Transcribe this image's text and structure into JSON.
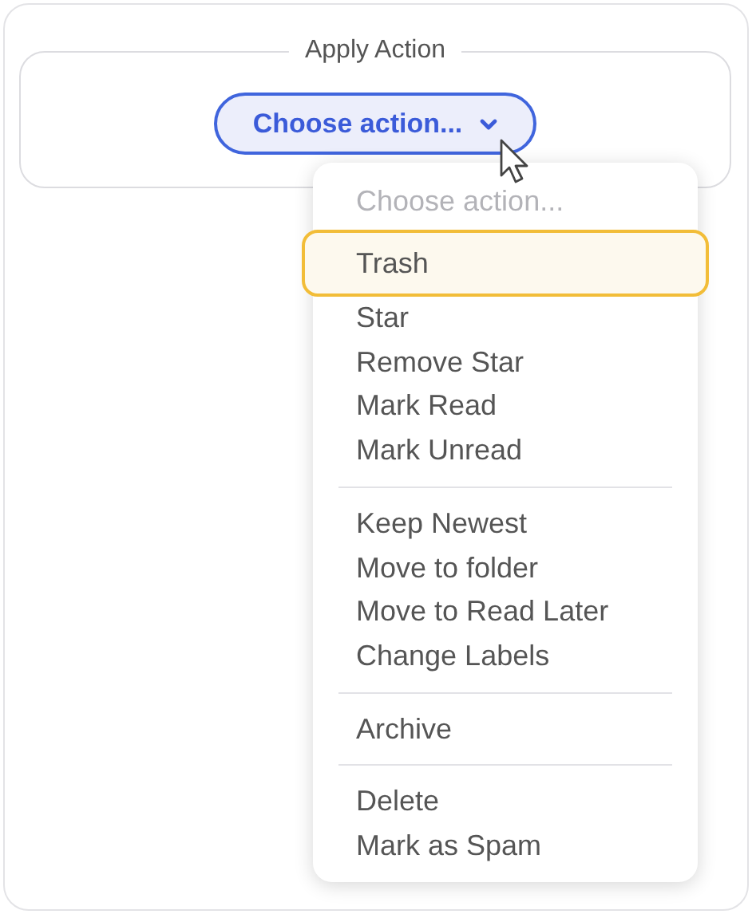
{
  "fieldset": {
    "legend": "Apply Action"
  },
  "select": {
    "value": "Choose action...",
    "expanded": true
  },
  "menu": {
    "placeholder": "Choose action...",
    "groups": [
      {
        "items": [
          {
            "label": "Trash",
            "selected": true
          },
          {
            "label": "Star",
            "selected": false
          },
          {
            "label": "Remove Star",
            "selected": false
          },
          {
            "label": "Mark Read",
            "selected": false
          },
          {
            "label": "Mark Unread",
            "selected": false
          }
        ]
      },
      {
        "items": [
          {
            "label": "Keep Newest",
            "selected": false
          },
          {
            "label": "Move to folder",
            "selected": false
          },
          {
            "label": "Move to Read Later",
            "selected": false
          },
          {
            "label": "Change Labels",
            "selected": false
          }
        ]
      },
      {
        "items": [
          {
            "label": "Archive",
            "selected": false
          }
        ]
      },
      {
        "items": [
          {
            "label": "Delete",
            "selected": false
          },
          {
            "label": "Mark as Spam",
            "selected": false
          }
        ]
      }
    ]
  }
}
